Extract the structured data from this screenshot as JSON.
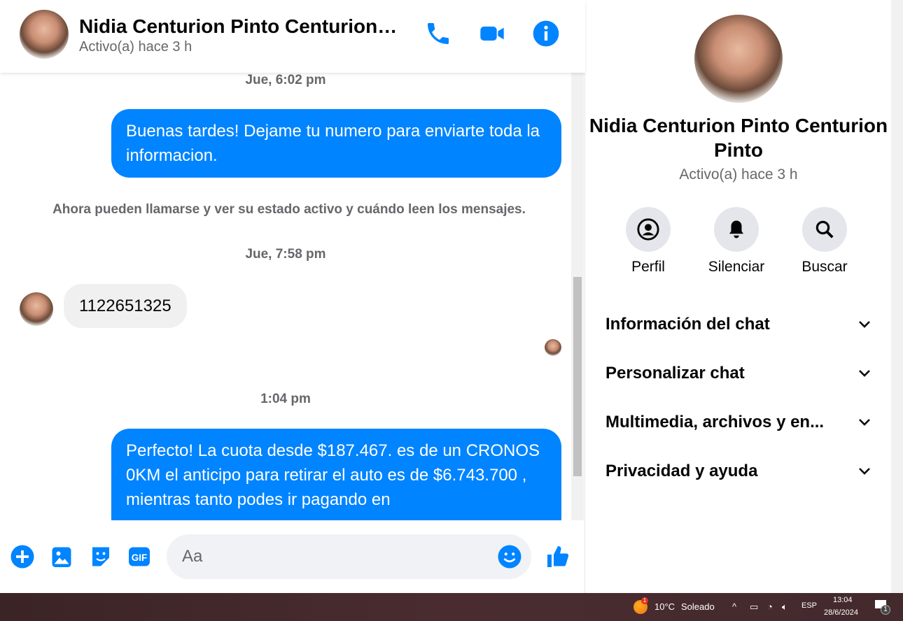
{
  "header": {
    "name": "Nidia Centurion Pinto Centurion Pinto",
    "status": "Activo(a) hace 3 h"
  },
  "messages": [
    {
      "type": "timestamp",
      "text": "Jue, 6:02 pm"
    },
    {
      "type": "outgoing",
      "text": "Buenas tardes! Dejame tu numero para enviarte toda la informacion."
    },
    {
      "type": "system",
      "text": "Ahora pueden llamarse y ver su estado activo y cuándo leen los mensajes."
    },
    {
      "type": "timestamp",
      "text": "Jue, 7:58 pm"
    },
    {
      "type": "incoming",
      "text": "1122651325"
    },
    {
      "type": "timestamp",
      "text": "1:04 pm"
    },
    {
      "type": "outgoing",
      "text": "Perfecto! La cuota desde $187.467. es de un CRONOS 0KM el anticipo para retirar el auto es de $6.743.700 , mientras tanto podes ir pagando en"
    }
  ],
  "composer": {
    "placeholder": "Aa"
  },
  "panel": {
    "name": "Nidia Centurion Pinto Centurion Pinto",
    "status": "Activo(a) hace 3 h",
    "actions": [
      "Perfil",
      "Silenciar",
      "Buscar"
    ],
    "sections": [
      "Información del chat",
      "Personalizar chat",
      "Multimedia, archivos y en...",
      "Privacidad y ayuda"
    ]
  },
  "taskbar": {
    "weather_badge": "1",
    "temp": "10°C",
    "weather": "Soleado",
    "lang": "ESP",
    "time": "13:04",
    "date": "28/6/2024",
    "notif_count": "1"
  },
  "colors": {
    "accent": "#0084ff"
  }
}
